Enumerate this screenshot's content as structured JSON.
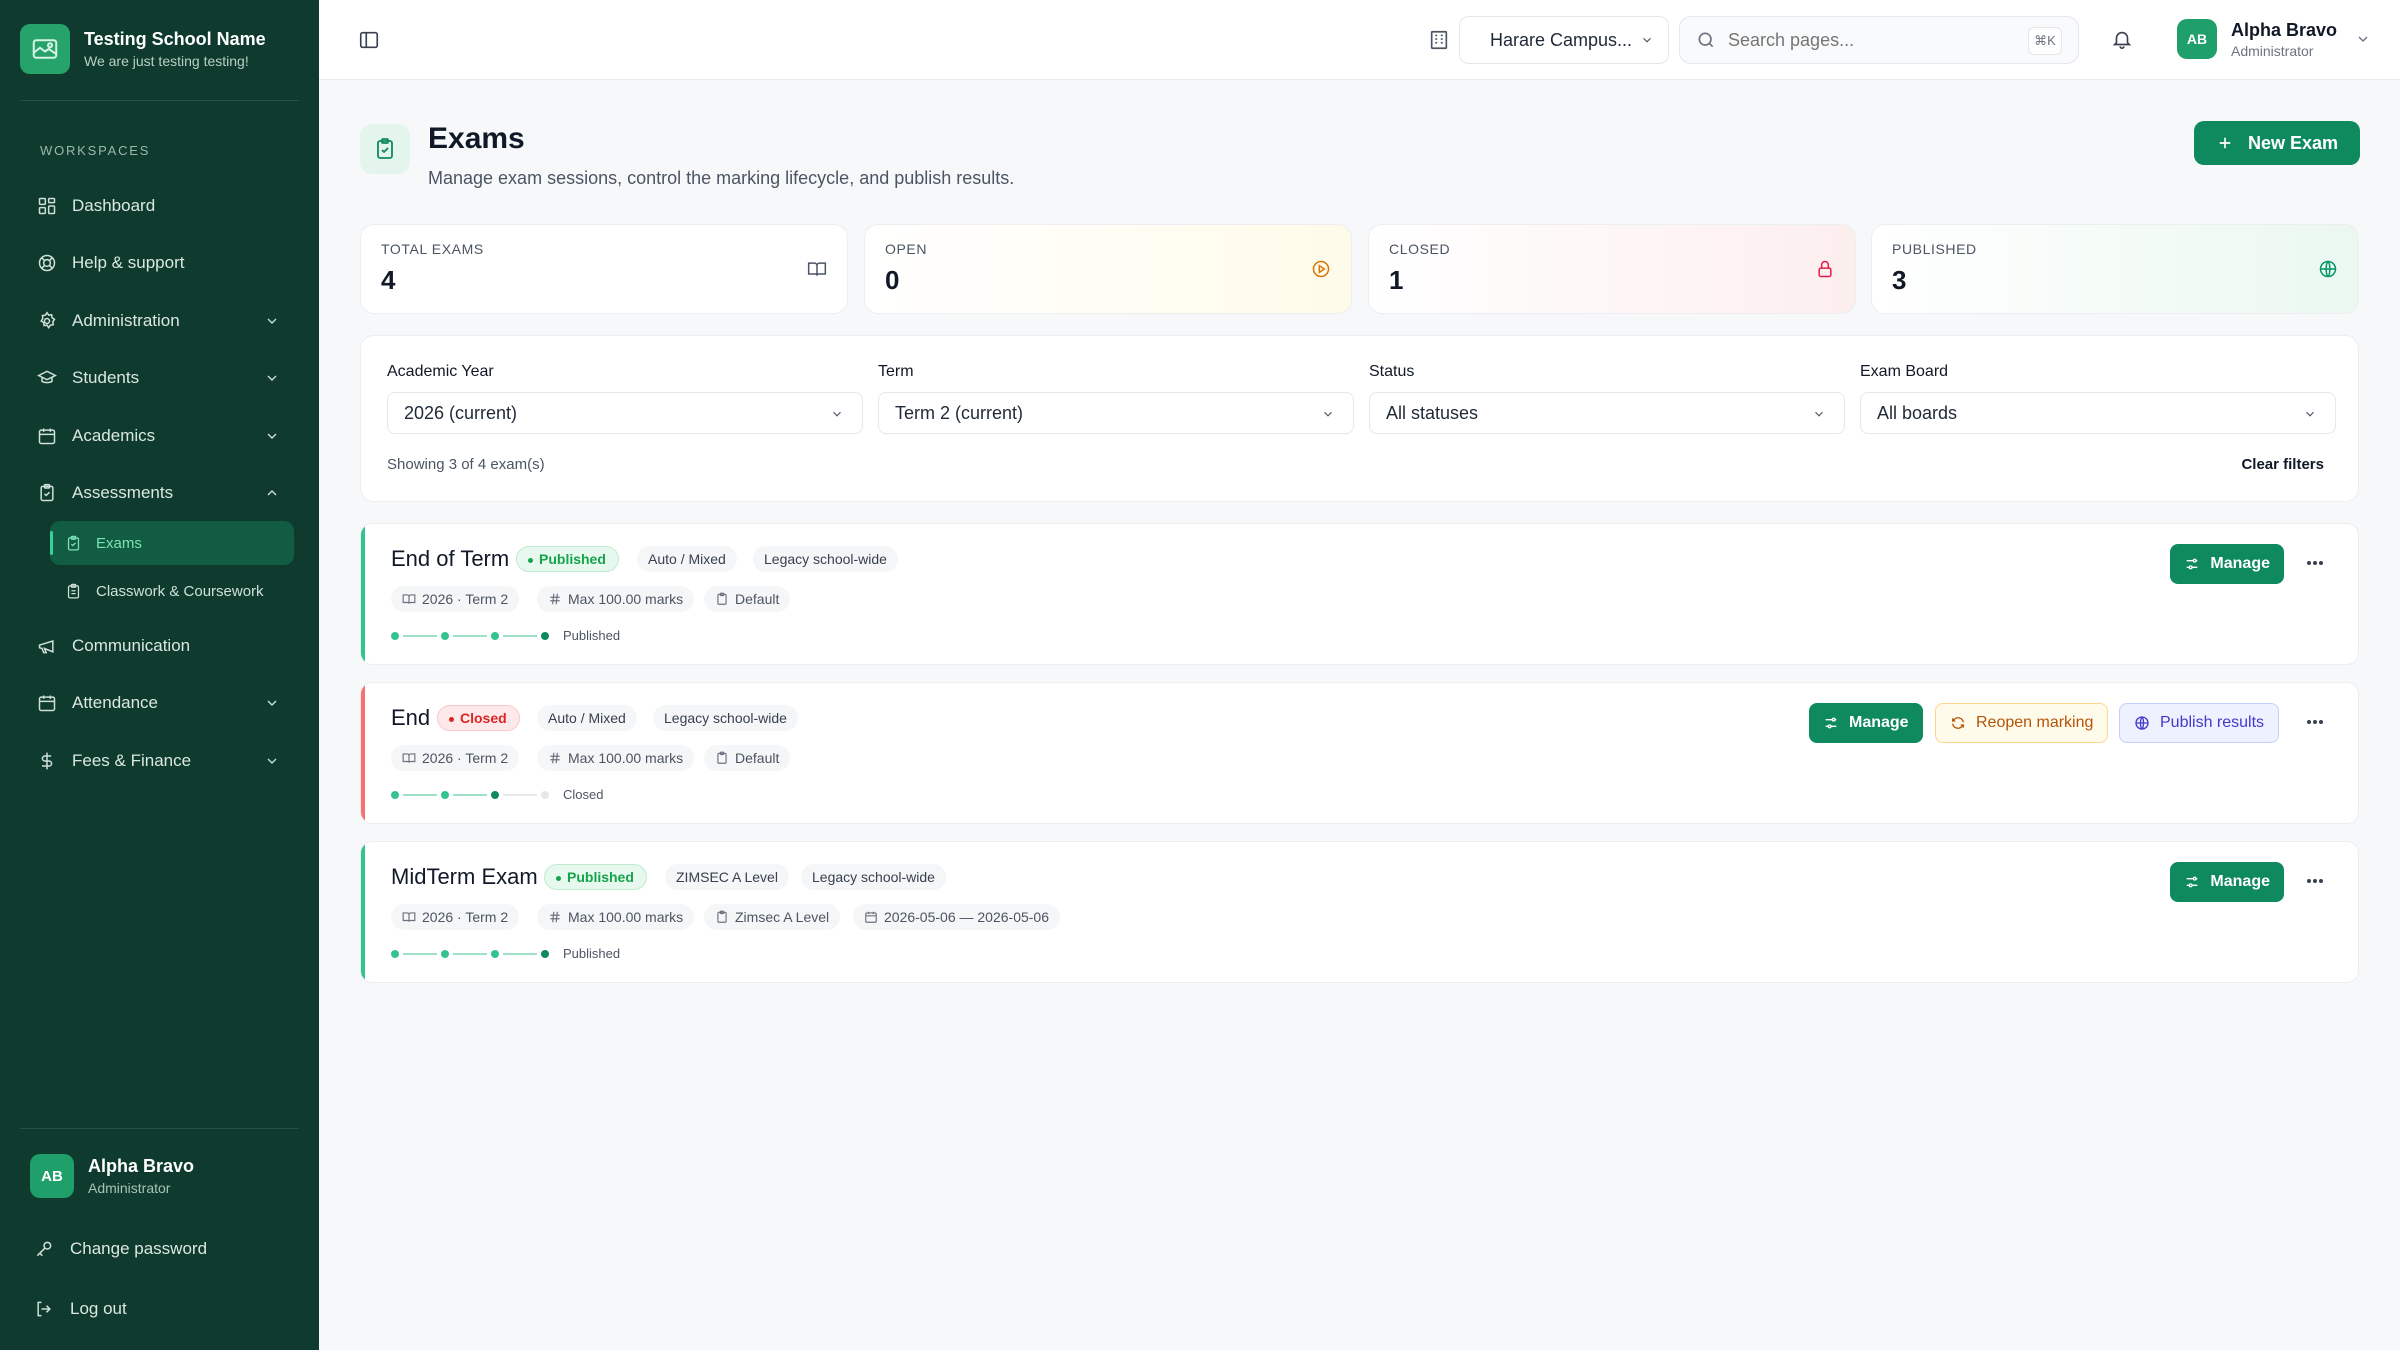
{
  "brand": {
    "name": "Testing School Name",
    "tagline": "We are just testing testing!"
  },
  "sidebar": {
    "section": "WORKSPACES",
    "items": [
      {
        "label": "Dashboard",
        "icon": "grid-icon"
      },
      {
        "label": "Help & support",
        "icon": "lifebuoy-icon"
      },
      {
        "label": "Administration",
        "icon": "gear-icon"
      },
      {
        "label": "Students",
        "icon": "graduation-cap-icon"
      },
      {
        "label": "Academics",
        "icon": "calendar-icon"
      },
      {
        "label": "Assessments",
        "icon": "clipboard-check-icon"
      },
      {
        "label": "Communication",
        "icon": "megaphone-icon"
      },
      {
        "label": "Attendance",
        "icon": "calendar-icon"
      },
      {
        "label": "Fees & Finance",
        "icon": "dollar-icon"
      }
    ],
    "sub_items": [
      {
        "label": "Exams",
        "icon": "clipboard-check-icon"
      },
      {
        "label": "Classwork & Coursework",
        "icon": "clipboard-icon"
      }
    ],
    "user": {
      "initials": "AB",
      "name": "Alpha Bravo",
      "role": "Administrator"
    },
    "change_password": "Change password",
    "logout": "Log out"
  },
  "topbar": {
    "campus": "Harare Campus...",
    "search_placeholder": "Search pages...",
    "shortcut": "⌘K",
    "user": {
      "initials": "AB",
      "name": "Alpha Bravo",
      "role": "Administrator"
    }
  },
  "page": {
    "title": "Exams",
    "subtitle": "Manage exam sessions, control the marking lifecycle, and publish results.",
    "new_button": "New Exam"
  },
  "stats": [
    {
      "label": "TOTAL EXAMS",
      "value": "4",
      "icon": "book-open-icon",
      "color": "#4b5563"
    },
    {
      "label": "OPEN",
      "value": "0",
      "icon": "play-circle-icon",
      "color": "#d97706"
    },
    {
      "label": "CLOSED",
      "value": "1",
      "icon": "lock-icon",
      "color": "#e11d48"
    },
    {
      "label": "PUBLISHED",
      "value": "3",
      "icon": "globe-icon",
      "color": "#059669"
    }
  ],
  "filters": {
    "academic_year": {
      "label": "Academic Year",
      "value": "2026 (current)"
    },
    "term": {
      "label": "Term",
      "value": "Term 2 (current)"
    },
    "status": {
      "label": "Status",
      "value": "All statuses"
    },
    "exam_board": {
      "label": "Exam Board",
      "value": "All boards"
    },
    "showing": "Showing 3 of 4 exam(s)",
    "clear": "Clear filters"
  },
  "exams": [
    {
      "title": "End of Term",
      "status": "Published",
      "chips": [
        "Auto / Mixed",
        "Legacy school-wide"
      ],
      "meta": [
        "2026 · Term 2",
        "Max 100.00 marks",
        "Default"
      ],
      "stage": "Published",
      "actions": {
        "manage": "Manage"
      }
    },
    {
      "title": "End",
      "status": "Closed",
      "chips": [
        "Auto / Mixed",
        "Legacy school-wide"
      ],
      "meta": [
        "2026 · Term 2",
        "Max 100.00 marks",
        "Default"
      ],
      "stage": "Closed",
      "actions": {
        "manage": "Manage",
        "reopen": "Reopen marking",
        "publish": "Publish results"
      }
    },
    {
      "title": "MidTerm Exam",
      "status": "Published",
      "chips": [
        "ZIMSEC A Level",
        "Legacy school-wide"
      ],
      "meta": [
        "2026 · Term 2",
        "Max 100.00 marks",
        "Zimsec A Level",
        "2026-05-06 — 2026-05-06"
      ],
      "stage": "Published",
      "actions": {
        "manage": "Manage"
      }
    }
  ],
  "colors": {
    "sidebar": "#0e3b2e",
    "accent": "#0f8a5f",
    "published": "#16a34a",
    "closed": "#dc2626"
  }
}
